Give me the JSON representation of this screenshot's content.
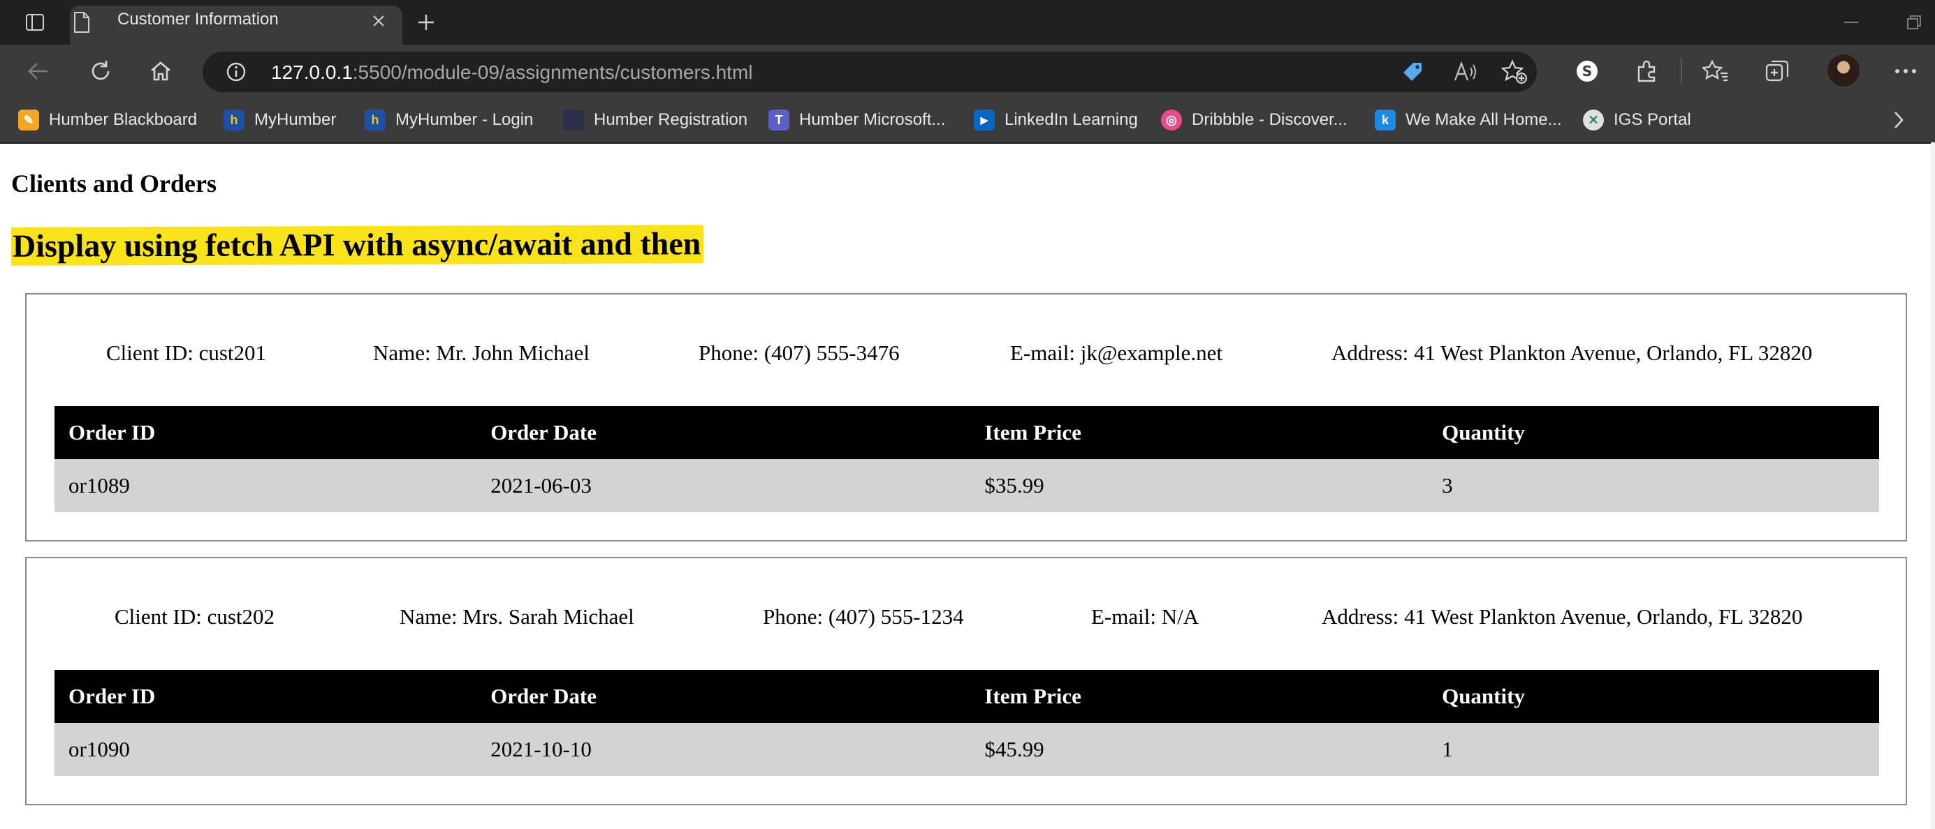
{
  "browser": {
    "tab_title": "Customer Information",
    "url_host": "127.0.0.1",
    "url_rest": ":5500/module-09/assignments/customers.html"
  },
  "bookmarks": [
    {
      "label": "Humber Blackboard",
      "icon": "blackboard-icon",
      "color": "#f5a623"
    },
    {
      "label": "MyHumber",
      "icon": "humber-icon",
      "color": "#1f4fa3"
    },
    {
      "label": "MyHumber - Login",
      "icon": "humber-icon",
      "color": "#1f4fa3"
    },
    {
      "label": "Humber Registration",
      "icon": "registration-icon",
      "color": "#2a2f4a"
    },
    {
      "label": "Humber Microsoft...",
      "icon": "teams-icon",
      "color": "#5b5fc7"
    },
    {
      "label": "LinkedIn Learning",
      "icon": "linkedin-learning-icon",
      "color": "#0a66c2"
    },
    {
      "label": "Dribbble - Discover...",
      "icon": "dribbble-icon",
      "color": "#ea4c89"
    },
    {
      "label": "We Make All Home...",
      "icon": "k-icon",
      "color": "#1e88e5"
    },
    {
      "label": "IGS Portal",
      "icon": "igs-icon",
      "color": "#e0e0e0"
    }
  ],
  "page": {
    "heading": "Clients and Orders",
    "subheading": "Display using fetch API with async/await and then",
    "highlight_color": "#f8e21a"
  },
  "table_headers": [
    "Order ID",
    "Order Date",
    "Item Price",
    "Quantity"
  ],
  "clients": [
    {
      "client_id": "Client ID: cust201",
      "name": "Name: Mr. John Michael",
      "phone": "Phone: (407) 555-3476",
      "email": "E-mail: jk@example.net",
      "address": "Address: 41 West Plankton Avenue, Orlando, FL 32820",
      "orders": [
        {
          "order_id": "or1089",
          "order_date": "2021-06-03",
          "item_price": "$35.99",
          "quantity": "3"
        }
      ]
    },
    {
      "client_id": "Client ID: cust202",
      "name": "Name: Mrs. Sarah Michael",
      "phone": "Phone: (407) 555-1234",
      "email": "E-mail: N/A",
      "address": "Address: 41 West Plankton Avenue, Orlando, FL 32820",
      "orders": [
        {
          "order_id": "or1090",
          "order_date": "2021-10-10",
          "item_price": "$45.99",
          "quantity": "1"
        }
      ]
    }
  ]
}
